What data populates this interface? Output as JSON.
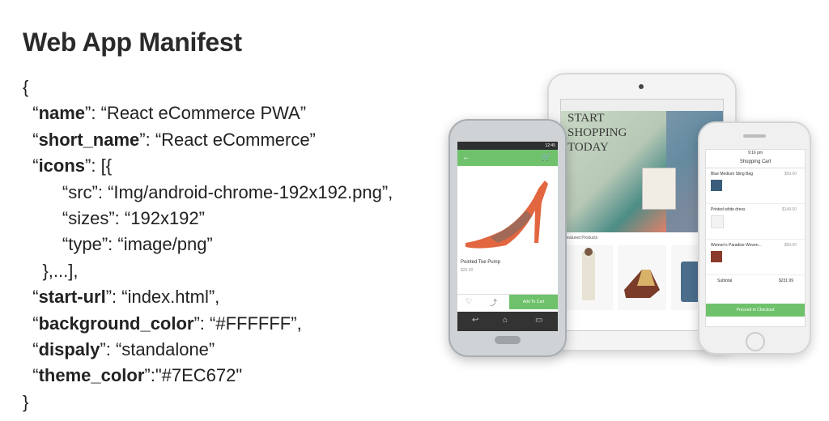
{
  "title": "Web App Manifest",
  "code": {
    "open": "{",
    "name_key": "name",
    "name_val": "“React eCommerce PWA”",
    "short_key": "short_name",
    "short_val": "“React eCommerce”",
    "icons_key": "icons",
    "icons_open": "[{",
    "src_line": "“src”: “Img/android-chrome-192x192.png”,",
    "sizes_line": "“sizes”: “192x192”",
    "type_line": "“type”: “image/png”",
    "icons_close": "},...],",
    "start_key": "start-url",
    "start_val": "“index.html”,",
    "bg_key": "background_color",
    "bg_val": "“#FFFFFF”,",
    "display_key": "dispaly",
    "display_val": "“standalone”",
    "theme_key": "theme_color",
    "theme_val": "\"#7EC672\"",
    "close": "}"
  },
  "tablet": {
    "hero_line1": "START",
    "hero_line2": "SHOPPING",
    "hero_line3": "TODAY",
    "featured": "Featured Products"
  },
  "android": {
    "time": "12:45",
    "product_name": "Pointed Toe Pump",
    "price": "$29.00",
    "add_to_cart": "Add To Cart"
  },
  "iphone": {
    "time": "9:16 pm",
    "header": "Shopping Cart",
    "items": [
      {
        "name": "Blue Medium Sling Bag",
        "price": "$59.00"
      },
      {
        "name": "Printed white dress",
        "price": "$149.00"
      },
      {
        "name": "Women's Paradise Woven...",
        "price": "$99.00"
      }
    ],
    "subtotal_label": "Subtotal",
    "subtotal_value": "$231.99",
    "checkout": "Proceed to Checkout"
  },
  "colors": {
    "accent": "#6fc26b",
    "title": "#2a2a2a"
  }
}
